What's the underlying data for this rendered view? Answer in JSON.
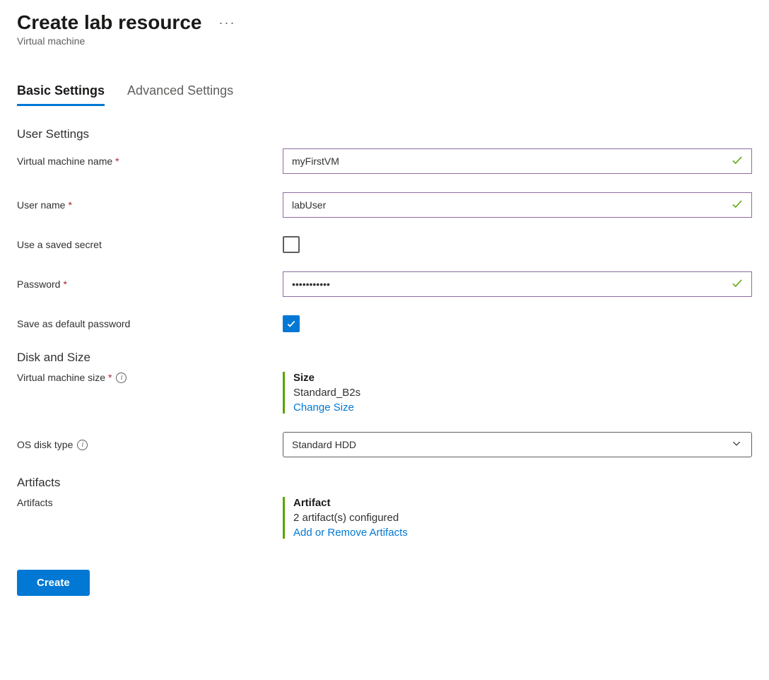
{
  "header": {
    "title": "Create lab resource",
    "subtitle": "Virtual machine"
  },
  "tabs": {
    "basic": "Basic Settings",
    "advanced": "Advanced Settings"
  },
  "sections": {
    "user_settings": "User Settings",
    "disk_size": "Disk and Size",
    "artifacts": "Artifacts"
  },
  "labels": {
    "vm_name": "Virtual machine name",
    "user_name": "User name",
    "saved_secret": "Use a saved secret",
    "password": "Password",
    "save_default_pw": "Save as default password",
    "vm_size": "Virtual machine size",
    "os_disk": "OS disk type",
    "artifacts": "Artifacts"
  },
  "values": {
    "vm_name": "myFirstVM",
    "user_name": "labUser",
    "password": "•••••••••••",
    "saved_secret_checked": false,
    "save_default_pw_checked": true,
    "os_disk_selected": "Standard HDD"
  },
  "size_card": {
    "title": "Size",
    "value": "Standard_B2s",
    "link": "Change Size"
  },
  "artifacts_card": {
    "title": "Artifact",
    "value": "2 artifact(s) configured",
    "link": "Add or Remove Artifacts"
  },
  "buttons": {
    "create": "Create"
  }
}
